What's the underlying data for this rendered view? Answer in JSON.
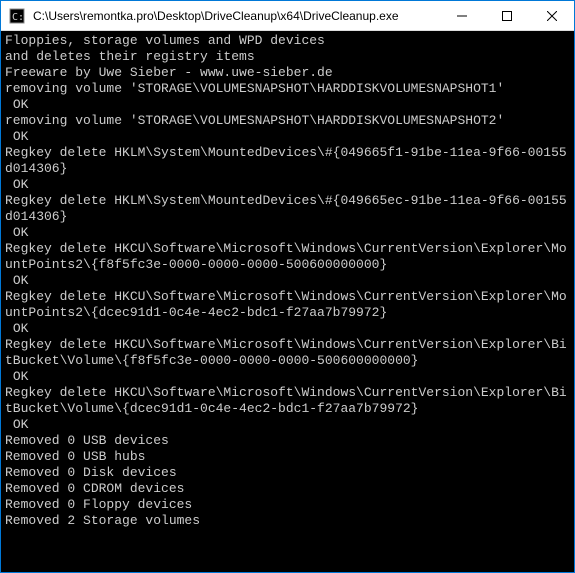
{
  "window": {
    "title": "C:\\Users\\remontka.pro\\Desktop\\DriveCleanup\\x64\\DriveCleanup.exe"
  },
  "console": {
    "lines": [
      "Floppies, storage volumes and WPD devices",
      "and deletes their registry items",
      "Freeware by Uwe Sieber - www.uwe-sieber.de",
      "",
      "removing volume 'STORAGE\\VOLUMESNAPSHOT\\HARDDISKVOLUMESNAPSHOT1'",
      " OK",
      "removing volume 'STORAGE\\VOLUMESNAPSHOT\\HARDDISKVOLUMESNAPSHOT2'",
      " OK",
      "Regkey delete HKLM\\System\\MountedDevices\\#{049665f1-91be-11ea-9f66-00155d014306}",
      " OK",
      "Regkey delete HKLM\\System\\MountedDevices\\#{049665ec-91be-11ea-9f66-00155d014306}",
      " OK",
      "Regkey delete HKCU\\Software\\Microsoft\\Windows\\CurrentVersion\\Explorer\\MountPoints2\\{f8f5fc3e-0000-0000-0000-500600000000}",
      " OK",
      "Regkey delete HKCU\\Software\\Microsoft\\Windows\\CurrentVersion\\Explorer\\MountPoints2\\{dcec91d1-0c4e-4ec2-bdc1-f27aa7b79972}",
      " OK",
      "Regkey delete HKCU\\Software\\Microsoft\\Windows\\CurrentVersion\\Explorer\\BitBucket\\Volume\\{f8f5fc3e-0000-0000-0000-500600000000}",
      " OK",
      "Regkey delete HKCU\\Software\\Microsoft\\Windows\\CurrentVersion\\Explorer\\BitBucket\\Volume\\{dcec91d1-0c4e-4ec2-bdc1-f27aa7b79972}",
      " OK",
      "",
      "Removed 0 USB devices",
      "Removed 0 USB hubs",
      "Removed 0 Disk devices",
      "Removed 0 CDROM devices",
      "Removed 0 Floppy devices",
      "Removed 2 Storage volumes"
    ]
  }
}
